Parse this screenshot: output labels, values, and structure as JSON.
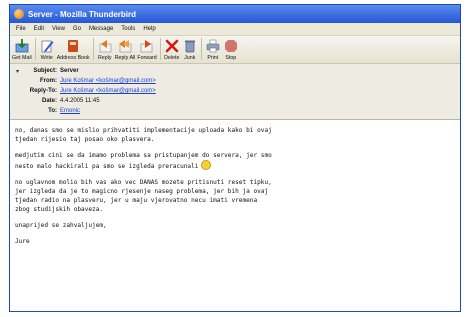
{
  "window": {
    "title": "Server - Mozilla Thunderbird"
  },
  "menu": [
    "File",
    "Edit",
    "View",
    "Go",
    "Message",
    "Tools",
    "Help"
  ],
  "toolbar": [
    {
      "name": "get-mail",
      "label": "Get Mail",
      "icon": "get-mail-icon",
      "color": "#2b7a2b"
    },
    {
      "name": "write",
      "label": "Write",
      "icon": "write-icon",
      "color": "#2f5ed6"
    },
    {
      "name": "address-book",
      "label": "Address Book",
      "icon": "address-book-icon",
      "color": "#c84b1d"
    },
    {
      "name": "reply",
      "label": "Reply",
      "icon": "reply-icon",
      "color": "#e07b18"
    },
    {
      "name": "reply-all",
      "label": "Reply All",
      "icon": "reply-all-icon",
      "color": "#e07b18"
    },
    {
      "name": "forward",
      "label": "Forward",
      "icon": "forward-icon",
      "color": "#d94a1a"
    },
    {
      "name": "delete",
      "label": "Delete",
      "icon": "delete-icon",
      "color": "#d81818"
    },
    {
      "name": "junk",
      "label": "Junk",
      "icon": "junk-icon",
      "color": "#5f6f8f"
    },
    {
      "name": "print",
      "label": "Print",
      "icon": "print-icon",
      "color": "#5a6e8a"
    },
    {
      "name": "stop",
      "label": "Stop",
      "icon": "stop-icon",
      "color": "#b5362b"
    }
  ],
  "headers": {
    "subject_label": "Subject:",
    "subject": "Server",
    "from_label": "From:",
    "from": "Jure Košmar <košmar@gmail.com>",
    "replyto_label": "Reply-To:",
    "replyto": "Jure Košmar <košmar@gmail.com>",
    "date_label": "Date:",
    "date": "4.4.2005 11:45",
    "to_label": "To:",
    "to": "Emonic"
  },
  "body": {
    "p1": "no, danas smo se mislio prihvatiti implementacije uploada kako bi ovaj\ntjedan rijesio taj posao oko plasvera.",
    "p2": "medjutim cini se da imamo problema sa pristupanjem do servera, jer smo\nnesto malo hackirali pa smo se izgleda preracunali",
    "p3": "no uglavnom molio bih vas ako vec DANAS mozete pritisnuti reset tipku,\njer izgleda da je to magicno rjesenje naseg problema, jer bih ja ovaj\ntjedan radio na plasveru, jer u maju vjerovatno necu imati vremena\nzbog studijskih obaveza.",
    "p4": "unaprijed se zahvaljujem,",
    "p5": "Jure"
  }
}
